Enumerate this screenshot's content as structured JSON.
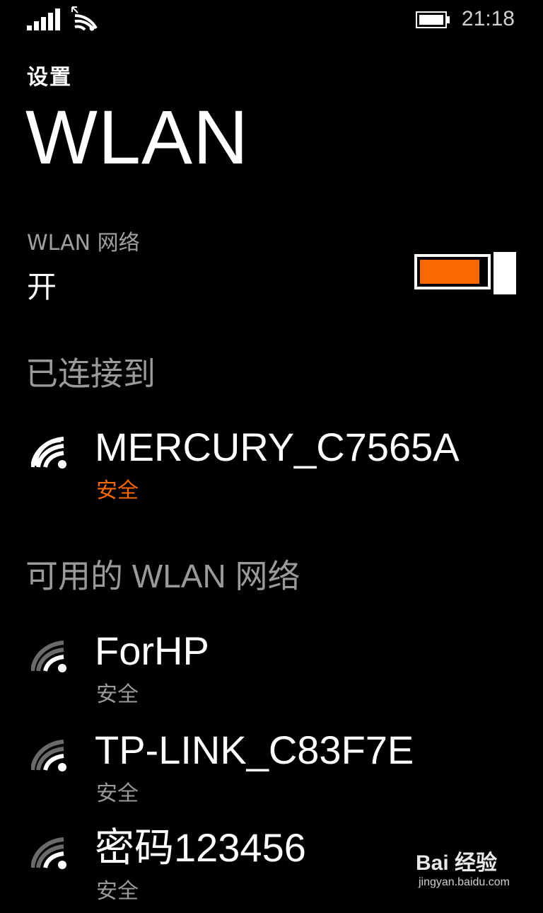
{
  "status_bar": {
    "time": "21:18",
    "icons": [
      "signal-icon",
      "wifi-icon",
      "battery-icon"
    ]
  },
  "header": {
    "app_title": "设置",
    "page_title": "WLAN"
  },
  "wlan_toggle": {
    "label": "WLAN 网络",
    "state": "开",
    "on": true
  },
  "connected": {
    "heading": "已连接到",
    "network": {
      "name": "MERCURY_C7565A",
      "status": "安全",
      "icon": "wifi-strong-icon"
    }
  },
  "available": {
    "heading": "可用的 WLAN 网络",
    "networks": [
      {
        "name": "ForHP",
        "status": "安全",
        "icon": "wifi-icon"
      },
      {
        "name": "TP-LINK_C83F7E",
        "status": "安全",
        "icon": "wifi-icon"
      },
      {
        "name": "密码123456",
        "status": "安全",
        "icon": "wifi-icon"
      }
    ]
  },
  "watermark": {
    "text": "Bai 经验",
    "url": "jingyan.baidu.com"
  },
  "colors": {
    "accent": "#fa6800",
    "background": "#000000",
    "secondary_text": "#9a9a9a"
  }
}
